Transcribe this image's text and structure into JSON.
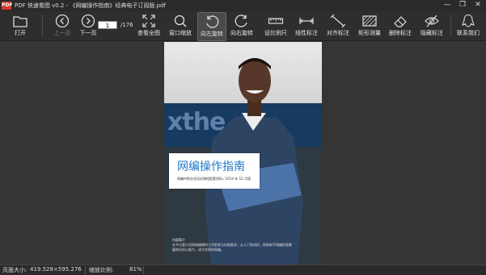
{
  "window": {
    "logo_text": "PDF",
    "title": "PDF 快速看图 v0.2 - 《网编操作指南》经典电子订阅版.pdf",
    "minimize": "—",
    "restore": "❐",
    "close": "✕"
  },
  "toolbar": {
    "open": "打开",
    "prev": "上一页",
    "next": "下一页",
    "current_page": "1",
    "total_pages": "/176",
    "fit_page": "查看全图",
    "fit_window": "窗口缩放",
    "rotate_left": "向左旋转",
    "rotate_right": "向右旋转",
    "set_ruler": "设比例尺",
    "linear_mark": "线性标注",
    "align_mark": "对齐标注",
    "area_measure": "矩形测量",
    "delete_mark": "删除标注",
    "hide_mark": "隐藏标注",
    "contact": "联系我们"
  },
  "document": {
    "banner_text": "xthe  co",
    "cover_title": "网编操作指南",
    "cover_subtitle": "网编中职业化培训课程配套资料 / 2014 年 12 月版",
    "note_label": "内容简介",
    "note_text": "本书主要介绍网络编辑的工作职责与技能要求，从入门到进阶，帮助新手网编快速掌握岗位核心能力，成为合格的网编。"
  },
  "status": {
    "page_size_label": "页面大小:",
    "page_size_value": "419.528×595.276",
    "zoom_label": "缩放比例:",
    "zoom_value": "81%"
  }
}
